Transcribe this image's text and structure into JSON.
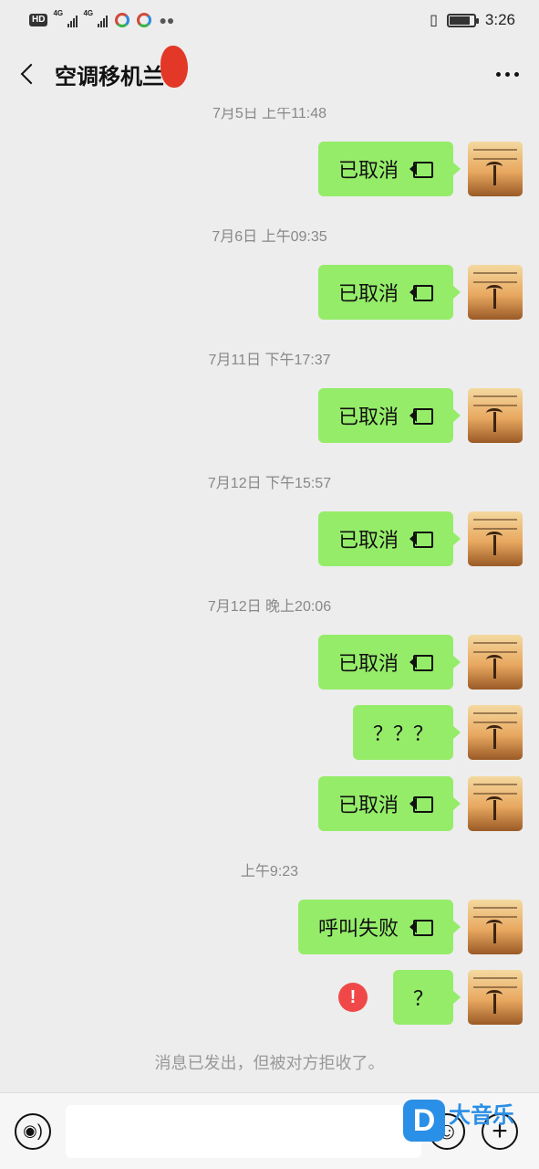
{
  "status_bar": {
    "hd_badge": "HD",
    "net_1": "4G",
    "net_2": "4G",
    "time": "3:26",
    "battery_level": 0.85
  },
  "header": {
    "title": "空调移机兰",
    "back_icon": "chevron-left-icon",
    "more_icon": "more-dots-icon"
  },
  "chat": {
    "timestamps": [
      "7月5日 上午11:48",
      "7月6日 上午09:35",
      "7月11日 下午17:37",
      "7月12日 下午15:57",
      "7月12日 晚上20:06",
      "上午9:23"
    ],
    "messages": [
      {
        "text": "已取消",
        "icon": "video-call-icon"
      },
      {
        "text": "已取消",
        "icon": "video-call-icon"
      },
      {
        "text": "已取消",
        "icon": "video-call-icon"
      },
      {
        "text": "已取消",
        "icon": "video-call-icon"
      },
      {
        "text": "已取消",
        "icon": "video-call-icon"
      },
      {
        "text": "？？？"
      },
      {
        "text": "已取消",
        "icon": "video-call-icon"
      },
      {
        "text": "呼叫失败",
        "icon": "video-call-icon"
      },
      {
        "text": "？",
        "status": "failed",
        "status_icon": "!"
      }
    ],
    "notice": "消息已发出，但被对方拒收了。"
  },
  "input_bar": {
    "voice_icon": "voice-icon",
    "voice_glyph": "◉)",
    "emoji_icon": "emoji-icon",
    "emoji_glyph": "☺",
    "plus_icon": "plus-icon",
    "plus_glyph": "+"
  },
  "watermark": {
    "logo_letter": "D",
    "text": "大音乐"
  },
  "colors": {
    "bubble": "#95ec69",
    "background": "#ededed",
    "error": "#f04848",
    "watermark": "#2a8fe6"
  }
}
